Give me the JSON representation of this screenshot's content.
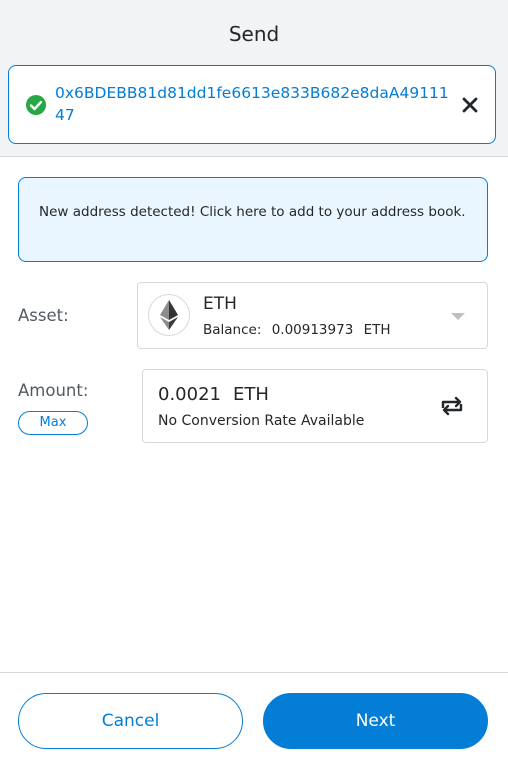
{
  "header": {
    "title": "Send",
    "recipient_address": "0x6BDEBB81d81dd1fe6613e833B682e8daA4911147"
  },
  "notice": {
    "text": "New address detected! Click here to add to your address book."
  },
  "asset": {
    "label": "Asset:",
    "symbol": "ETH",
    "balance_label": "Balance:",
    "balance_value": "0.00913973",
    "balance_unit": "ETH",
    "icon": "ethereum-logo"
  },
  "amount": {
    "label": "Amount:",
    "max_label": "Max",
    "value": "0.0021",
    "unit": "ETH",
    "conversion_text": "No Conversion Rate Available"
  },
  "footer": {
    "cancel_label": "Cancel",
    "next_label": "Next"
  },
  "colors": {
    "accent": "#037dd6",
    "success": "#28a745",
    "header_bg": "#f2f3f4",
    "notice_bg": "#eaf6ff"
  }
}
